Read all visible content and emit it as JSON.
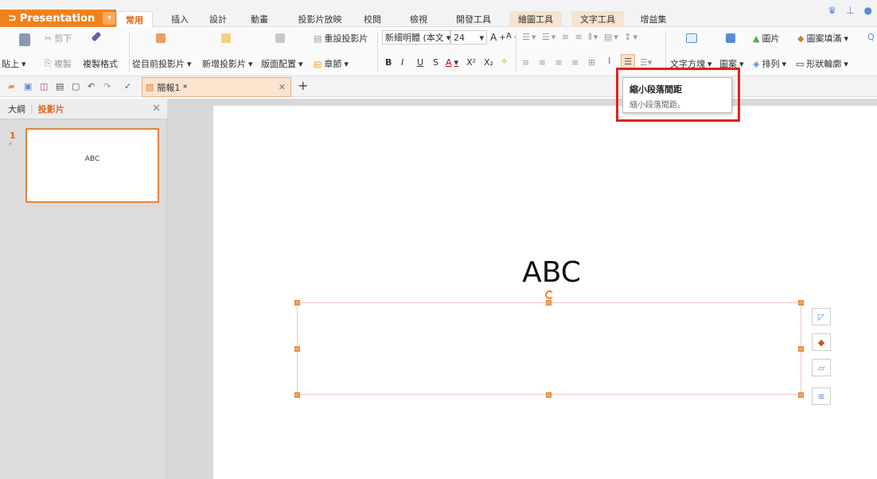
{
  "app": {
    "name": "Presentation",
    "accent": "#f0821e"
  },
  "menu": {
    "tabs": [
      {
        "label": "常用",
        "active": true
      },
      {
        "label": "插入"
      },
      {
        "label": "設計"
      },
      {
        "label": "動畫"
      },
      {
        "label": "投影片放映"
      },
      {
        "label": "校閱"
      },
      {
        "label": "檢視"
      },
      {
        "label": "開發工具"
      },
      {
        "label": "繪圖工具",
        "tool": true
      },
      {
        "label": "文字工具",
        "tool": true
      },
      {
        "label": "增益集"
      }
    ]
  },
  "ribbon": {
    "cut": "剪下",
    "copy": "複製",
    "format_painter": "複製格式",
    "paste": "貼上",
    "from_current": "從目前投影片",
    "new_slide": "新增投影片",
    "layout": "版面配置",
    "reset_slide": "重設投影片",
    "section": "章節",
    "font_name": "新細明體 (本文",
    "font_size": "24",
    "bold": "B",
    "italic": "I",
    "underline": "U",
    "strike": "S",
    "font_color": "A",
    "superscript": "X²",
    "subscript": "X₂",
    "text_box": "文字方塊",
    "shape": "圖案",
    "picture": "圖片",
    "fill": "圖案填滿",
    "arrange": "排列",
    "outline": "形狀輪廓"
  },
  "doc": {
    "tab_title": "簡報1 *",
    "new_tab": "+"
  },
  "panel": {
    "tabs": [
      "大綱",
      "投影片"
    ],
    "active_tab": "投影片",
    "slides": [
      {
        "number": "1",
        "star": "*",
        "text": "ABC"
      }
    ]
  },
  "slide": {
    "title": "ABC"
  },
  "tooltip": {
    "title": "縮小段落間距",
    "description": "縮小段落間距。"
  }
}
